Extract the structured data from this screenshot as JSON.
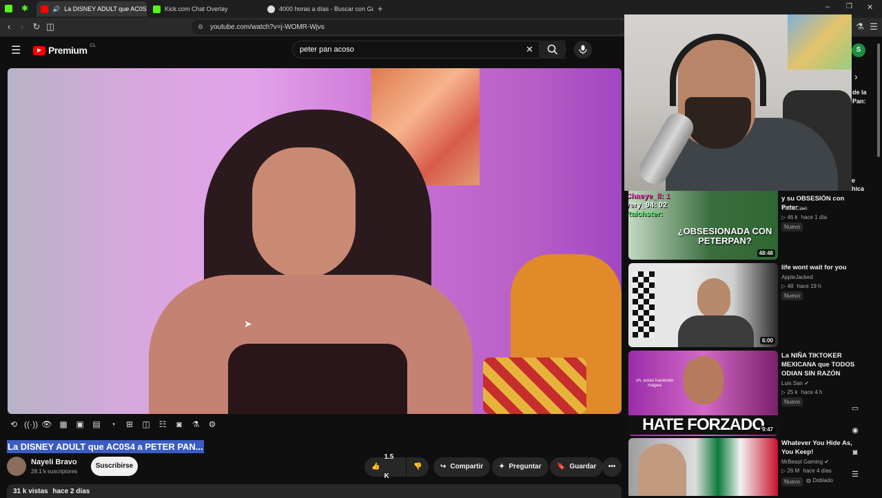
{
  "browser": {
    "tabs": [
      {
        "label": "La DISNEY ADULT que AC0S4",
        "active": true
      },
      {
        "label": "Kick.com Chat Overlay",
        "active": false
      },
      {
        "label": "4000 horas a días - Buscar con Goog",
        "active": false
      }
    ],
    "url": "youtube.com/watch?v=j-WOMR-Wjvs"
  },
  "youtube": {
    "logo": "Premium",
    "region": "CL",
    "search_value": "peter pan acoso"
  },
  "video": {
    "title": "La DISNEY ADULT que AC0S4 a PETER PAN...",
    "channel": "Nayeli Bravo",
    "subscribers": "28.1 k suscriptores",
    "subscribe_label": "Suscribirse",
    "likes": "1.5 K",
    "share": "Compartir",
    "ask": "Preguntar",
    "save": "Guardar",
    "views": "31 k vistas",
    "posted": "hace 2 días"
  },
  "partial_text": {
    "line1": "de la",
    "line2": "Pan:",
    "line3": "e",
    "line4": "hica"
  },
  "recommendations": [
    {
      "title": "y su OBSESIÓN con Peter ...",
      "channel": "TwinsCore",
      "views": "46 k",
      "age": "hace 1 día",
      "badge": "Nuevo",
      "duration": "48:48",
      "overlay_lines": [
        "Chaeye_ll: 1",
        "yery_94: 02",
        "Raichster:"
      ],
      "thumb_text": "¿OBSESIONADA CON PETERPAN?"
    },
    {
      "title": "life wont wait for you",
      "channel": "AppleJacked",
      "views": "48",
      "age": "hace 19 h",
      "badge": "Nuevo",
      "duration": "6:00"
    },
    {
      "title": "La NIÑA TIKTOKER MEXICANA que TODOS ODIAN SIN RAZÓN",
      "channel": "Luis San",
      "views": "25 k",
      "age": "hace 4 h",
      "badge": "Nuevo",
      "duration": "9:47",
      "thumb_text": "HATE FORZADO",
      "caption": "oh, estas haciendo magea"
    },
    {
      "title": "Whatever You Hide As, You Keep!",
      "channel": "MrBeast Gaming",
      "views": "26 M",
      "age": "hace 4 días",
      "badge": "Nuevo",
      "badge2": "Doblado"
    }
  ]
}
